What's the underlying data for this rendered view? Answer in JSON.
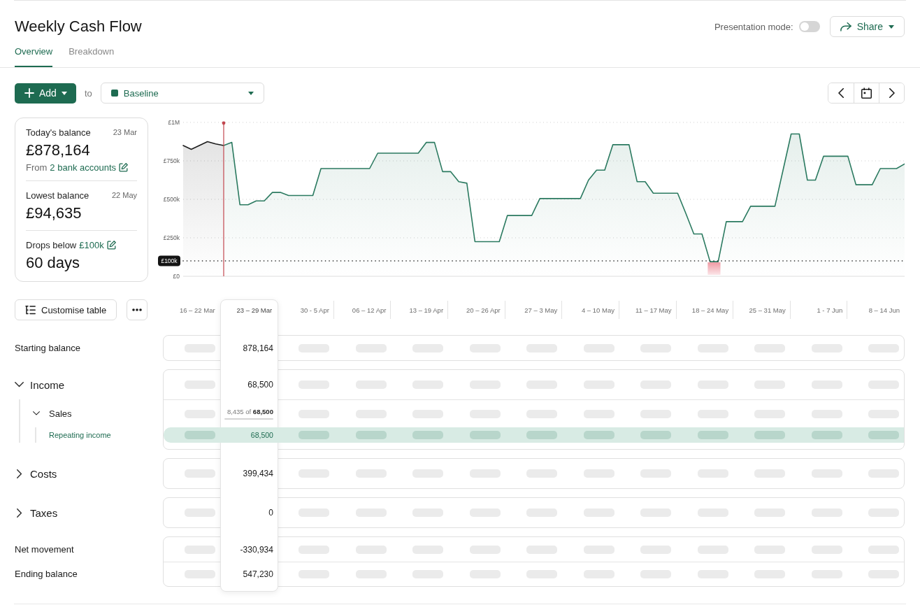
{
  "header": {
    "title": "Weekly Cash Flow",
    "presentation_mode": {
      "label": "Presentation mode:",
      "on": false
    },
    "share_button": {
      "label": "Share"
    }
  },
  "tabs": [
    {
      "label": "Overview",
      "selected": true
    },
    {
      "label": "Breakdown",
      "selected": false
    }
  ],
  "toolbar": {
    "add_button": {
      "label": "Add"
    },
    "connector": "to",
    "scenario": {
      "value": "Baseline"
    }
  },
  "summary": [
    {
      "title": "Today's balance",
      "date": "23 Mar",
      "value": "£878,164",
      "note": "From",
      "link": "2 bank accounts"
    },
    {
      "title": "Lowest balance",
      "date": "22 May",
      "value": "£94,635"
    },
    {
      "title": "Drops below",
      "title_link": "£100k",
      "value": "60 days"
    }
  ],
  "balance_chart": {
    "chart_data": {
      "type": "area",
      "ylim": [
        0,
        1000000
      ],
      "yticks": [
        {
          "value": 0,
          "label": "£0"
        },
        {
          "value": 250000,
          "label": "£250k"
        },
        {
          "value": 500000,
          "label": "£500k"
        },
        {
          "value": 750000,
          "label": "£750k"
        },
        {
          "value": 1000000,
          "label": "£1M"
        }
      ],
      "tick_labels": "y",
      "grid": true,
      "categories": [
        null,
        null,
        null,
        null,
        null,
        null,
        null,
        null,
        null,
        null,
        null,
        null,
        null,
        null,
        null,
        null,
        null,
        null,
        null,
        null,
        null,
        null,
        null,
        null,
        null,
        null,
        null,
        null,
        null,
        null,
        null,
        null,
        null,
        null,
        null,
        null,
        null,
        null,
        null,
        null,
        null,
        null,
        null,
        null,
        null,
        null,
        null,
        null,
        null,
        null,
        null,
        null,
        null,
        null,
        null,
        null,
        null,
        null,
        null,
        null,
        null,
        null,
        null,
        null,
        null,
        null,
        null,
        null,
        null,
        null,
        null,
        null,
        null,
        null,
        null,
        null,
        null,
        null,
        null,
        null,
        null,
        null,
        null,
        null,
        null,
        null,
        null,
        null,
        null,
        null
      ],
      "series": [
        {
          "color": "#1c1c1c",
          "values": [
            850000,
            825000,
            850000,
            875000,
            860000,
            850000,
            null,
            null,
            null,
            null,
            null,
            null,
            null,
            null,
            null,
            null,
            null,
            null,
            null,
            null,
            null,
            null,
            null,
            null,
            null,
            null,
            null,
            null,
            null,
            null,
            null,
            null,
            null,
            null,
            null,
            null,
            null,
            null,
            null,
            null,
            null,
            null,
            null,
            null,
            null,
            null,
            null,
            null,
            null,
            null,
            null,
            null,
            null,
            null,
            null,
            null,
            null,
            null,
            null,
            null,
            null,
            null,
            null,
            null,
            null,
            null,
            null,
            null,
            null,
            null,
            null,
            null,
            null,
            null,
            null,
            null,
            null,
            null,
            null,
            null,
            null,
            null,
            null,
            null,
            null,
            null,
            null,
            null,
            null,
            null
          ]
        },
        {
          "color": "#2b7a60",
          "values": [
            null,
            null,
            null,
            null,
            null,
            850000,
            870000,
            465000,
            465000,
            490000,
            490000,
            545000,
            545000,
            525000,
            525000,
            525000,
            525000,
            700000,
            700000,
            700000,
            700000,
            700000,
            700000,
            700000,
            800000,
            800000,
            800000,
            800000,
            800000,
            800000,
            870000,
            870000,
            680000,
            680000,
            615000,
            605000,
            225000,
            225000,
            225000,
            225000,
            395000,
            395000,
            395000,
            395000,
            505000,
            505000,
            505000,
            505000,
            505000,
            505000,
            625000,
            690000,
            690000,
            855000,
            855000,
            855000,
            615000,
            615000,
            540000,
            540000,
            540000,
            540000,
            410000,
            275000,
            275000,
            95000,
            95000,
            355000,
            355000,
            355000,
            455000,
            455000,
            455000,
            455000,
            690000,
            925000,
            925000,
            625000,
            625000,
            780000,
            780000,
            780000,
            780000,
            595000,
            595000,
            595000,
            700000,
            700000,
            700000,
            730000
          ]
        }
      ],
      "ref_lines": [
        {
          "axis": "y",
          "value": 100000,
          "label": "£100k",
          "color": "#141414",
          "line_style": "dotted"
        }
      ]
    }
  },
  "table": {
    "customise_button": {
      "label": "Customise table"
    },
    "columns": [
      {
        "label": "16 – 22 Mar",
        "selected": false
      },
      {
        "label": "23 – 29 Mar",
        "selected": true
      },
      {
        "label": "30 - 5 Apr",
        "selected": false
      },
      {
        "label": "06 – 12 Apr",
        "selected": false
      },
      {
        "label": "13 – 19 Apr",
        "selected": false
      },
      {
        "label": "20 – 26 Apr",
        "selected": false
      },
      {
        "label": "27 – 3 May",
        "selected": false
      },
      {
        "label": "4 – 10 May",
        "selected": false
      },
      {
        "label": "11 – 17 May",
        "selected": false
      },
      {
        "label": "18 – 24 May",
        "selected": false
      },
      {
        "label": "25 – 31 May",
        "selected": false
      },
      {
        "label": "1 - 7 Jun",
        "selected": false
      },
      {
        "label": "8 – 14 Jun",
        "selected": false
      }
    ],
    "sections": [
      {
        "rows": [
          {
            "kind": "total",
            "label": "Starting balance",
            "value": "878,164"
          }
        ]
      },
      {
        "rows": [
          {
            "kind": "group",
            "label": "Income",
            "value": "68,500",
            "expanded": true,
            "children": [
              {
                "kind": "subgroup",
                "label": "Sales",
                "value": "8,435 of **68,500**",
                "expanded": true,
                "children": [
                  {
                    "kind": "line",
                    "label": "Repeating income",
                    "value": "68,500",
                    "highlighted": true
                  }
                ]
              }
            ]
          }
        ]
      },
      {
        "rows": [
          {
            "kind": "group",
            "label": "Costs",
            "value": "399,434",
            "expanded": false
          }
        ]
      },
      {
        "rows": [
          {
            "kind": "group",
            "label": "Taxes",
            "value": "0",
            "expanded": false
          }
        ]
      },
      {
        "rows": [
          {
            "kind": "total",
            "label": "Net movement",
            "value": "-330,934"
          },
          {
            "kind": "total",
            "label": "Ending balance",
            "value": "547,230"
          }
        ]
      }
    ]
  }
}
